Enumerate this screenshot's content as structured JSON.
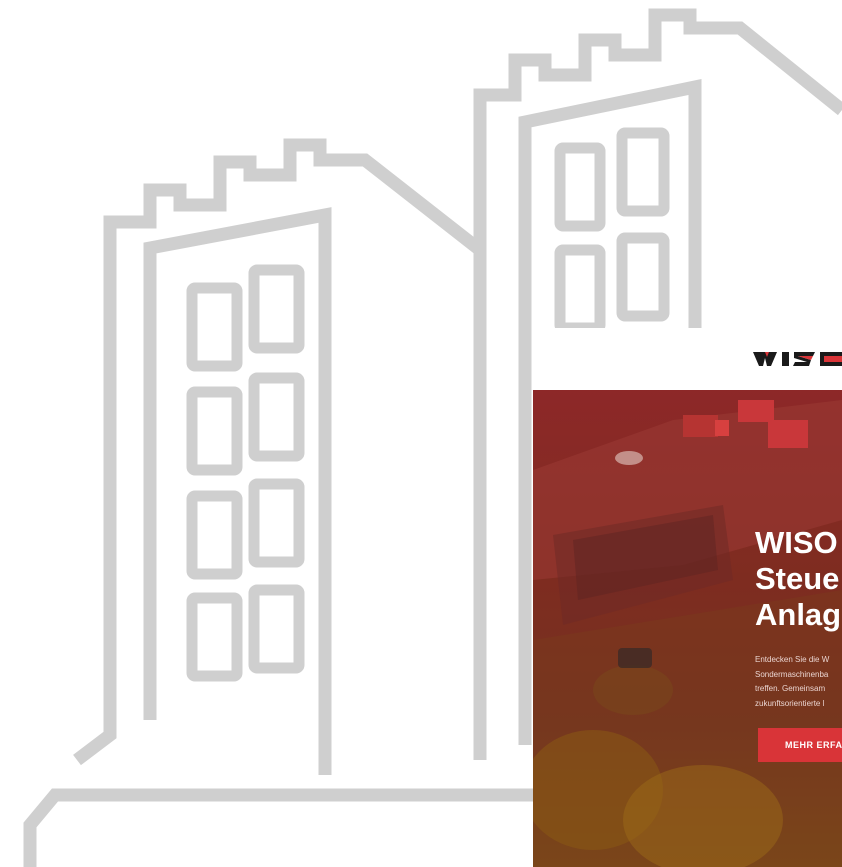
{
  "illustration": {
    "subject": "two outlined high-rise buildings",
    "stroke_color": "#cfcfcf"
  },
  "preview": {
    "logo": {
      "text": "WISO",
      "colors": [
        "#1a1a1a",
        "#d93438"
      ]
    },
    "hero": {
      "title": "WISO\nSteue\nAnlag",
      "text": "Entdecken Sie die W\nSondermaschinenba\ntreffen. Gemeinsam\nzukunftsorientierte l",
      "cta_label": "MEHR ERFA",
      "overlay_color": "#8d2828",
      "cta_color": "#d93438"
    }
  }
}
